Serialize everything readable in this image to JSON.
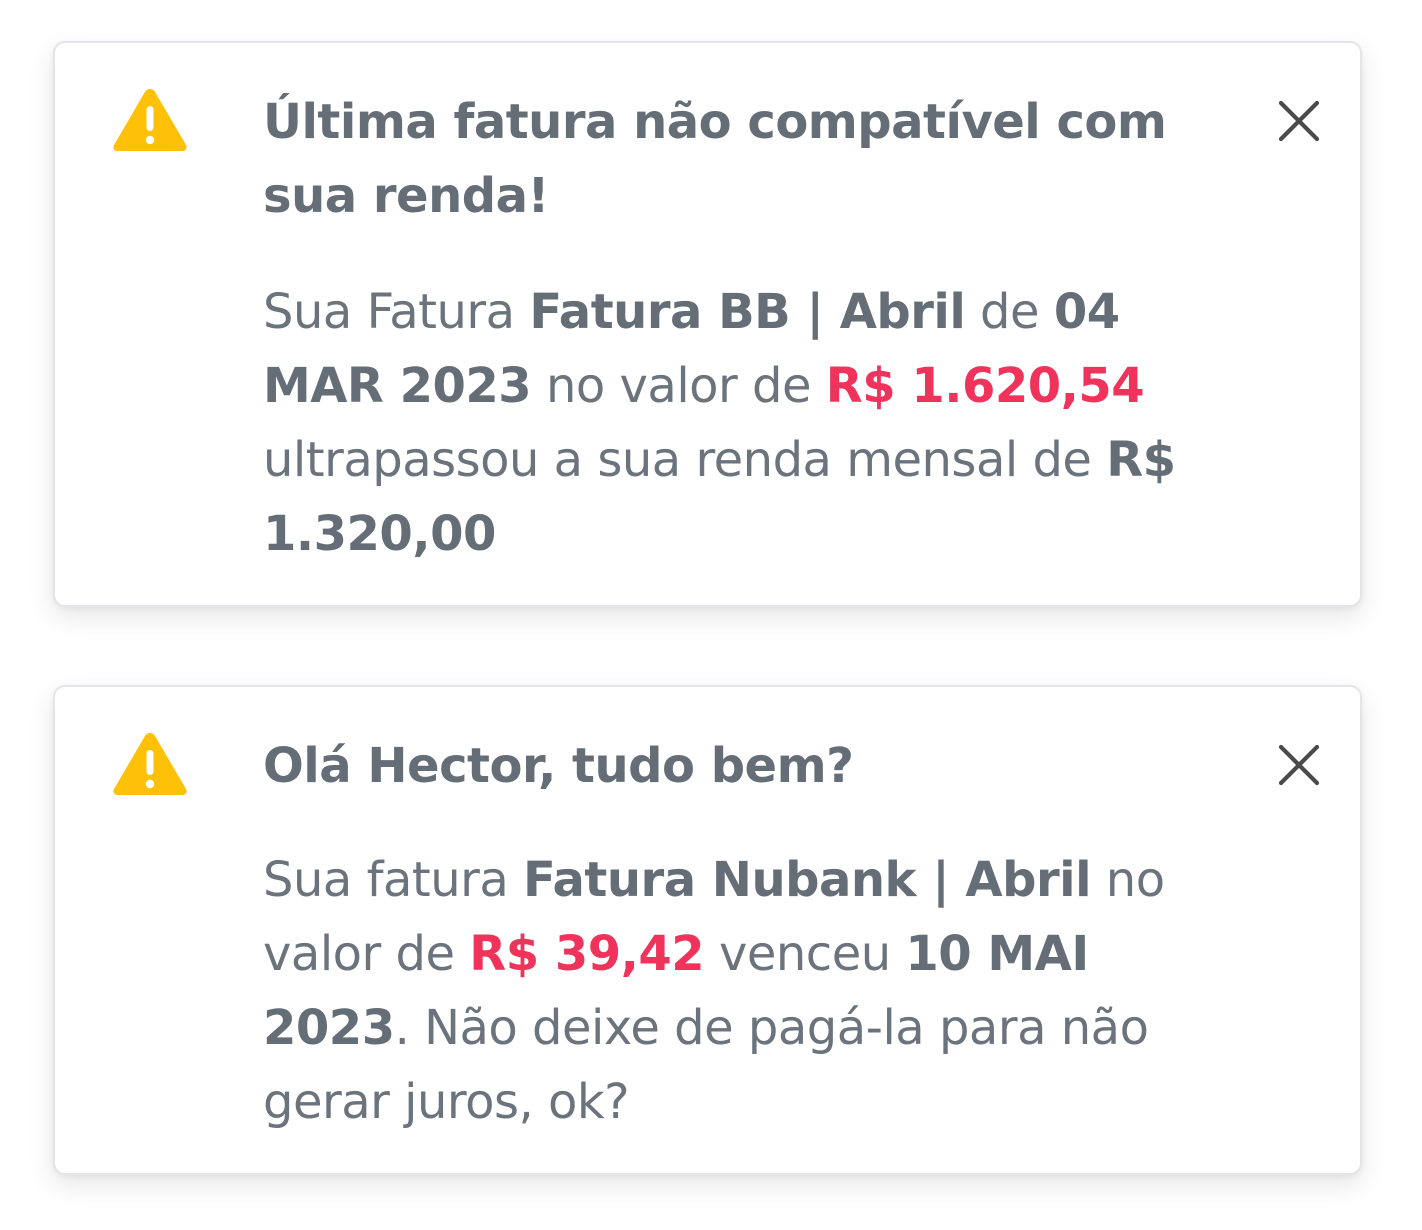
{
  "colors": {
    "warning": "#ffc107",
    "amount": "#f0335b",
    "text": "#6b737d",
    "border": "#e4e5e8"
  },
  "alerts": [
    {
      "icon": "warning-icon",
      "title": "Última fatura não compatível com sua renda!",
      "body": {
        "p1": "Sua Fatura ",
        "invoice": "Fatura BB | Abril",
        "p2": " de ",
        "date": "04 MAR 2023",
        "p3": " no valor de ",
        "amount": "R$ 1.620,54",
        "p4": " ultrapassou a sua renda mensal de ",
        "income": "R$ 1.320,00"
      },
      "close_icon": "close-icon"
    },
    {
      "icon": "warning-icon",
      "title": "Olá Hector, tudo bem?",
      "body": {
        "p1": "Sua fatura ",
        "invoice": "Fatura Nubank | Abril",
        "p2": " no valor de ",
        "amount": "R$ 39,42",
        "p3": " venceu ",
        "date": "10 MAI 2023",
        "p4": ". Não deixe de pagá-la para não gerar juros, ok?"
      },
      "close_icon": "close-icon"
    }
  ]
}
